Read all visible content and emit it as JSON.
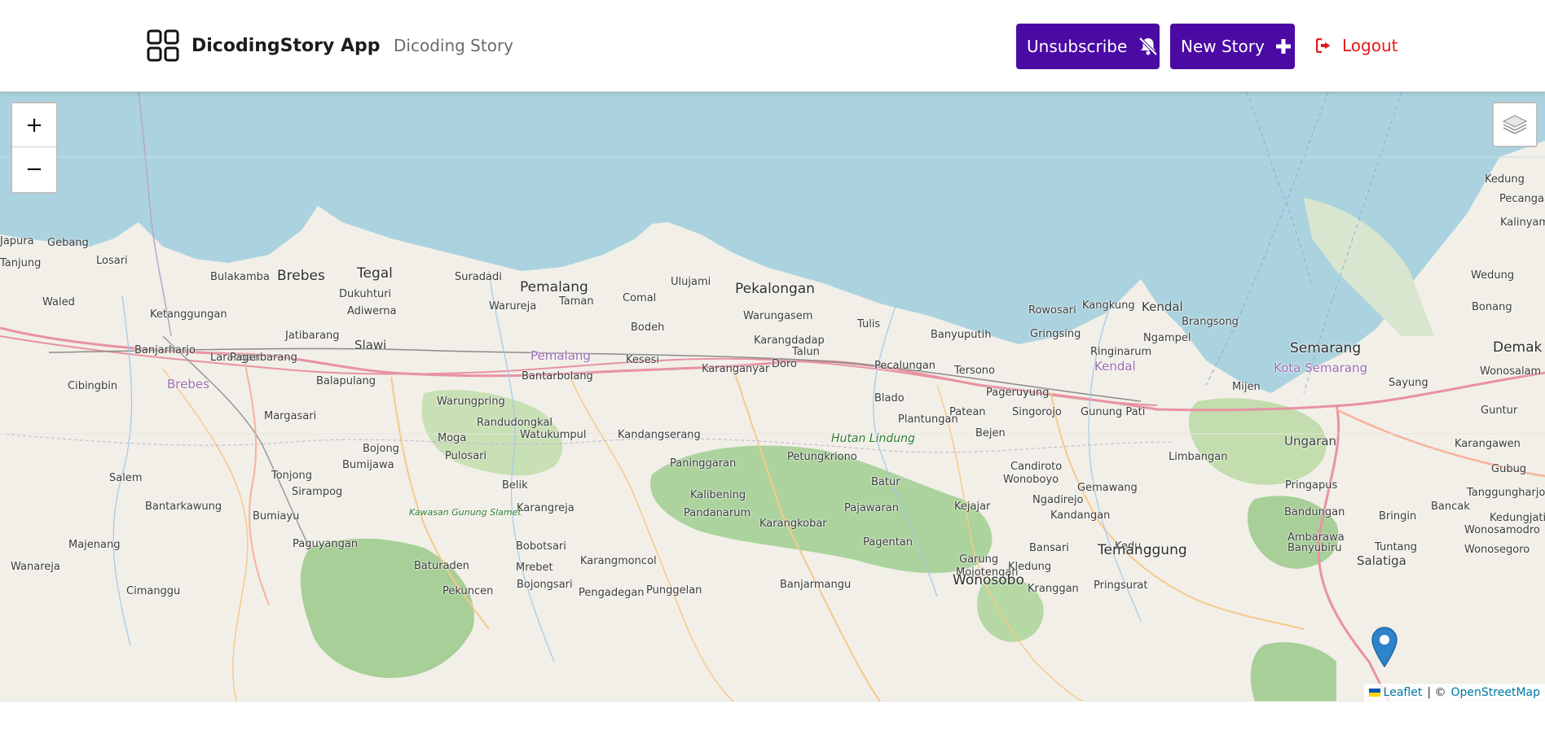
{
  "header": {
    "app_name": "DicodingStory App",
    "nav_link": "Dicoding Story",
    "unsubscribe_label": "Unsubscribe",
    "new_story_label": "New Story",
    "logout_label": "Logout",
    "brand_color": "#4b0aa3",
    "logout_color": "#e31a1a"
  },
  "map": {
    "zoom_in": "+",
    "zoom_out": "−",
    "attribution": {
      "leaflet": "Leaflet",
      "separator": "| ©",
      "osm": "OpenStreetMap"
    },
    "places": [
      "Japura",
      "Gebang",
      "Losari",
      "Tanjung",
      "Bulakamba",
      "Brebes",
      "Tegal",
      "Suradadi",
      "Pemalang",
      "Ulujami",
      "Pekalongan",
      "Dukuhturi",
      "Adiwerna",
      "Warureja",
      "Taman",
      "Comal",
      "Waled",
      "Ketanggungan",
      "Jatibarang",
      "Slawi",
      "Bodeh",
      "Karangdadap",
      "Warungasem",
      "Tulis",
      "Banyuputih",
      "Gringsing",
      "Rowosari",
      "Kangkung",
      "Kendal",
      "Brangsong",
      "Ngampel",
      "Ringinarum",
      "Semarang",
      "Kota Semarang",
      "Kedung",
      "Pecangaan",
      "Kalinyamatan",
      "Wedung",
      "Bonang",
      "Demak",
      "Wonosalam",
      "Sayung",
      "Guntur",
      "Karangawen",
      "Gubug",
      "Tanggungharjo",
      "Kedungjati",
      "Banjarharjo",
      "Larangan",
      "Pagerbarang",
      "Brebes",
      "Pemalang",
      "Kesesi",
      "Karanganyar",
      "Doro",
      "Talun",
      "Pecalungan",
      "Tersono",
      "Pageruyung",
      "Kendal",
      "Mijen",
      "Bantarbolang",
      "Cibingbin",
      "Balapulang",
      "Margasari",
      "Warungpring",
      "Randudongkal",
      "Blado",
      "Patean",
      "Singorojo",
      "Gunung Pati",
      "Plantungan",
      "Bejen",
      "Ungaran",
      "Limbangan",
      "Kandangserang",
      "Moga",
      "Bojong",
      "Pulosari",
      "Watukumpul",
      "Paninggaran",
      "Petungkriono",
      "Hutan Lindung",
      "Candiroto",
      "Gemawang",
      "Pringapus",
      "Salem",
      "Bumijawa",
      "Tonjong",
      "Sirampog",
      "Belik",
      "Kalibening",
      "Batur",
      "Wonoboyo",
      "Ngadirejo",
      "Bandungan",
      "Bancak",
      "Bantarkawung",
      "Bumiayu",
      "Karangreja",
      "Pandanarum",
      "Pajawaran",
      "Kejajar",
      "Kandangan",
      "Ambarawa",
      "Bringin",
      "Kawasan Gunung Slamet",
      "Majenang",
      "Paguyangan",
      "Karangkobar",
      "Pagentan",
      "Garung",
      "Bansari",
      "Kedu",
      "Banyubiru",
      "Tuntang",
      "Wonosamodro",
      "Wonosegoro",
      "Wanareja",
      "Baturaden",
      "Bobotsari",
      "Mrebet",
      "Karangmoncol",
      "Mojotengah",
      "Temanggung",
      "Salatiga",
      "Cimanggu",
      "Pekuncen",
      "Bojongsari",
      "Pengadegan",
      "Punggelan",
      "Banjarmangu",
      "Wonosobo",
      "Kledung",
      "Kranggan",
      "Pringsurat"
    ]
  }
}
